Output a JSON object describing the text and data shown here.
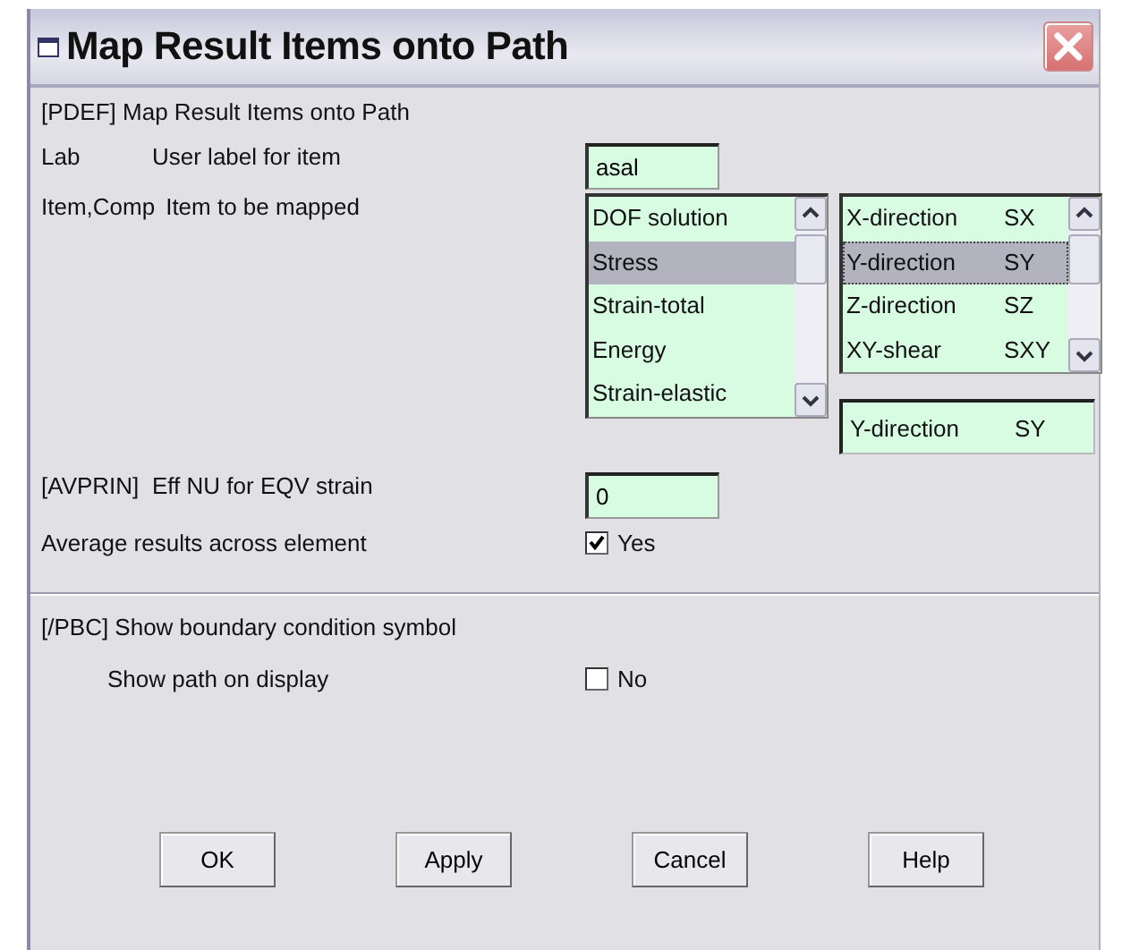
{
  "window": {
    "title": "Map Result Items onto Path"
  },
  "heading": "[PDEF] Map Result Items onto Path",
  "fields": [
    {
      "kind": "text",
      "code": "Lab",
      "label": "User label for item",
      "value": "asal"
    },
    {
      "kind": "lists",
      "code": "Item,Comp",
      "label": "Item to be mapped",
      "items": [
        {
          "label": "DOF solution",
          "selected": false
        },
        {
          "label": "Stress",
          "selected": true
        },
        {
          "label": "Strain-total",
          "selected": false
        },
        {
          "label": "Energy",
          "selected": false
        },
        {
          "label": "Strain-elastic",
          "selected": false
        }
      ],
      "components": [
        {
          "name": "X-direction",
          "code": "SX",
          "selected": false
        },
        {
          "name": "Y-direction",
          "code": "SY",
          "selected": true
        },
        {
          "name": "Z-direction",
          "code": "SZ",
          "selected": false
        },
        {
          "name": "XY-shear",
          "code": "SXY",
          "selected": false
        }
      ],
      "chosen": {
        "name": "Y-direction",
        "code": "SY"
      }
    },
    {
      "kind": "text",
      "code": "[AVPRIN]",
      "label": "Eff NU for EQV strain",
      "value": "0"
    },
    {
      "kind": "check",
      "label": "Average results across element",
      "checked": true,
      "text": "Yes"
    }
  ],
  "display": {
    "heading": "[/PBC] Show boundary condition symbol",
    "label": "Show path on display",
    "checked": false,
    "text": "No"
  },
  "buttons": [
    "OK",
    "Apply",
    "Cancel",
    "Help"
  ]
}
